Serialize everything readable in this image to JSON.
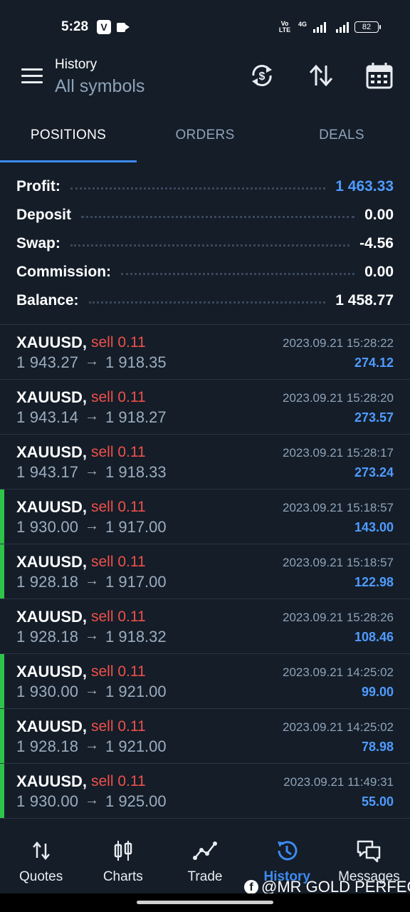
{
  "status_bar": {
    "time": "5:28",
    "app_badge": "V",
    "volte": "Vo LTE",
    "network": "4G",
    "battery": "82"
  },
  "header": {
    "subtitle": "History",
    "title": "All symbols",
    "icons": [
      "menu-icon",
      "currency-sync-icon",
      "sort-icon",
      "calendar-icon"
    ]
  },
  "tabs": [
    {
      "label": "POSITIONS",
      "active": true
    },
    {
      "label": "ORDERS",
      "active": false
    },
    {
      "label": "DEALS",
      "active": false
    }
  ],
  "summary": [
    {
      "label": "Profit:",
      "value": "1 463.33"
    },
    {
      "label": "Deposit",
      "value": "0.00"
    },
    {
      "label": "Swap:",
      "value": "-4.56"
    },
    {
      "label": "Commission:",
      "value": "0.00"
    },
    {
      "label": "Balance:",
      "value": "1 458.77"
    }
  ],
  "positions": [
    {
      "symbol": "XAUUSD,",
      "side": "sell 0.11",
      "open": "1 943.27",
      "arrow": "→",
      "close": "1 918.35",
      "time": "2023.09.21 15:28:22",
      "profit": "274.12",
      "marked": false
    },
    {
      "symbol": "XAUUSD,",
      "side": "sell 0.11",
      "open": "1 943.14",
      "arrow": "→",
      "close": "1 918.27",
      "time": "2023.09.21 15:28:20",
      "profit": "273.57",
      "marked": false
    },
    {
      "symbol": "XAUUSD,",
      "side": "sell 0.11",
      "open": "1 943.17",
      "arrow": "→",
      "close": "1 918.33",
      "time": "2023.09.21 15:28:17",
      "profit": "273.24",
      "marked": false
    },
    {
      "symbol": "XAUUSD,",
      "side": "sell 0.11",
      "open": "1 930.00",
      "arrow": "→",
      "close": "1 917.00",
      "time": "2023.09.21 15:18:57",
      "profit": "143.00",
      "marked": true
    },
    {
      "symbol": "XAUUSD,",
      "side": "sell 0.11",
      "open": "1 928.18",
      "arrow": "→",
      "close": "1 917.00",
      "time": "2023.09.21 15:18:57",
      "profit": "122.98",
      "marked": true
    },
    {
      "symbol": "XAUUSD,",
      "side": "sell 0.11",
      "open": "1 928.18",
      "arrow": "→",
      "close": "1 918.32",
      "time": "2023.09.21 15:28:26",
      "profit": "108.46",
      "marked": false
    },
    {
      "symbol": "XAUUSD,",
      "side": "sell 0.11",
      "open": "1 930.00",
      "arrow": "→",
      "close": "1 921.00",
      "time": "2023.09.21 14:25:02",
      "profit": "99.00",
      "marked": true
    },
    {
      "symbol": "XAUUSD,",
      "side": "sell 0.11",
      "open": "1 928.18",
      "arrow": "→",
      "close": "1 921.00",
      "time": "2023.09.21 14:25:02",
      "profit": "78.98",
      "marked": true
    },
    {
      "symbol": "XAUUSD,",
      "side": "sell 0.11",
      "open": "1 930.00",
      "arrow": "→",
      "close": "1 925.00",
      "time": "2023.09.21 11:49:31",
      "profit": "55.00",
      "marked": true
    }
  ],
  "bottom_nav": [
    {
      "label": "Quotes",
      "icon": "quotes-icon",
      "active": false
    },
    {
      "label": "Charts",
      "icon": "charts-icon",
      "active": false
    },
    {
      "label": "Trade",
      "icon": "trade-icon",
      "active": false
    },
    {
      "label": "History",
      "icon": "history-icon",
      "active": true
    },
    {
      "label": "Messages",
      "icon": "messages-icon",
      "active": false
    }
  ],
  "watermark": "@MR GOLD PERFECT",
  "colors": {
    "background": "#141d28",
    "accent_blue": "#3d8bf0",
    "profit_blue": "#4f9bff",
    "sell_red": "#f0504a",
    "marker_green": "#2ec44a",
    "muted_text": "#8fa3b8"
  }
}
